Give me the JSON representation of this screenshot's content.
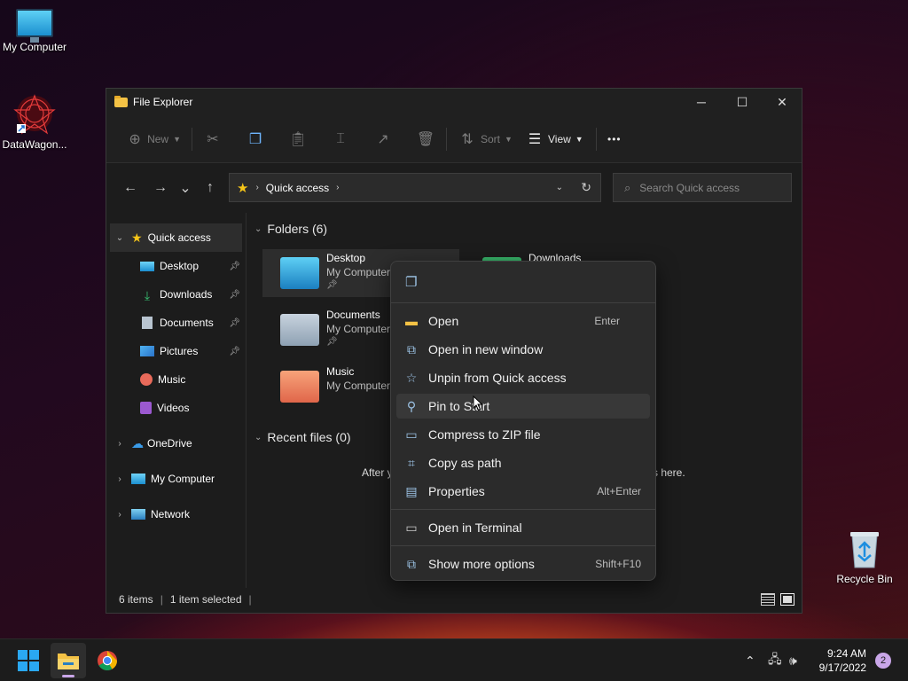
{
  "desktop": {
    "icons": [
      {
        "label": "My Computer"
      },
      {
        "label": "DataWagon..."
      },
      {
        "label": "Recycle Bin"
      }
    ]
  },
  "window": {
    "title": "File Explorer",
    "controls": {
      "minimize": "─",
      "maximize": "☐",
      "close": "✕"
    }
  },
  "commandbar": {
    "new_label": "New",
    "sort_label": "Sort",
    "view_label": "View",
    "more": "•••"
  },
  "nav": {
    "back": "←",
    "forward": "→",
    "recent": "⌄",
    "up": "↑",
    "address": "Quick access",
    "search_placeholder": "Search Quick access"
  },
  "sidebar": {
    "quick_access": "Quick access",
    "items": [
      {
        "label": "Desktop",
        "pinned": true
      },
      {
        "label": "Downloads",
        "pinned": true
      },
      {
        "label": "Documents",
        "pinned": true
      },
      {
        "label": "Pictures",
        "pinned": true
      },
      {
        "label": "Music",
        "pinned": false
      },
      {
        "label": "Videos",
        "pinned": false
      }
    ],
    "onedrive": "OneDrive",
    "mycomputer": "My Computer",
    "network": "Network"
  },
  "content": {
    "folders_header": "Folders (6)",
    "recent_header": "Recent files (0)",
    "recent_empty_left": "After y",
    "recent_empty_right": "s here.",
    "folders": [
      {
        "name": "Desktop",
        "sub": "My Computer",
        "pinned": true
      },
      {
        "name": "Downloads",
        "sub": "",
        "pinned": false
      },
      {
        "name": "Documents",
        "sub": "My Computer",
        "pinned": true
      },
      {
        "name": "Music",
        "sub": "My Computer",
        "pinned": false
      }
    ]
  },
  "status": {
    "items": "6 items",
    "selected": "1 item selected"
  },
  "context_menu": {
    "items": [
      {
        "label": "Open",
        "shortcut": "Enter"
      },
      {
        "label": "Open in new window",
        "shortcut": ""
      },
      {
        "label": "Unpin from Quick access",
        "shortcut": ""
      },
      {
        "label": "Pin to Start",
        "shortcut": ""
      },
      {
        "label": "Compress to ZIP file",
        "shortcut": ""
      },
      {
        "label": "Copy as path",
        "shortcut": ""
      },
      {
        "label": "Properties",
        "shortcut": "Alt+Enter"
      },
      {
        "label": "Open in Terminal",
        "shortcut": ""
      },
      {
        "label": "Show more options",
        "shortcut": "Shift+F10"
      }
    ],
    "hovered_index": 3
  },
  "taskbar": {
    "time": "9:24 AM",
    "date": "9/17/2022",
    "notifications": "2"
  },
  "colors": {
    "accent": "#0078d4",
    "window_bg": "#1c1c1c",
    "menu_bg": "#2b2b2b"
  }
}
